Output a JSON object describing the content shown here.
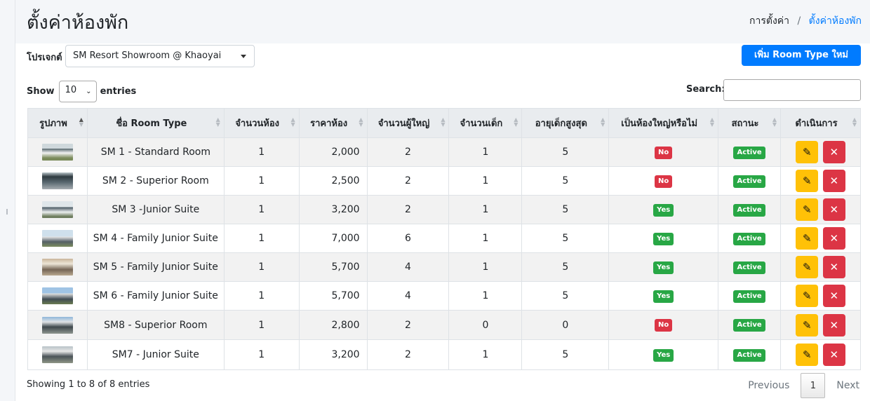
{
  "header": {
    "title": "ตั้งค่าห้องพัก",
    "breadcrumb": [
      "การตั้งค่า",
      "ตั้งค่าห้องพัก"
    ]
  },
  "filters": {
    "project_label": "โปรเจกต์",
    "project_value": "SM Resort Showroom @ Khaoyai",
    "add_button": "เพิ่ม Room Type ใหม่",
    "show_label": "Show",
    "entries_value": "10",
    "entries_label": "entries",
    "search_label": "Search:",
    "search_value": ""
  },
  "table": {
    "columns": [
      "รูปภาพ",
      "ชื่อ Room Type",
      "จำนวนห้อง",
      "ราคาห้อง",
      "จำนวนผู้ใหญ่",
      "จำนวนเด็ก",
      "อายุเด็กสูงสุด",
      "เป็นห้องใหญ่หรือไม่",
      "สถานะ",
      "ดำเนินการ"
    ],
    "rows": [
      {
        "name": "SM 1 - Standard Room",
        "rooms": "1",
        "price": "2,000",
        "adults": "2",
        "children": "1",
        "max_child_age": "5",
        "large": "No",
        "status": "Active"
      },
      {
        "name": "SM 2 - Superior Room",
        "rooms": "1",
        "price": "2,500",
        "adults": "2",
        "children": "1",
        "max_child_age": "5",
        "large": "No",
        "status": "Active"
      },
      {
        "name": "SM 3 -Junior Suite",
        "rooms": "1",
        "price": "3,200",
        "adults": "2",
        "children": "1",
        "max_child_age": "5",
        "large": "Yes",
        "status": "Active"
      },
      {
        "name": "SM 4 - Family Junior Suite",
        "rooms": "1",
        "price": "7,000",
        "adults": "6",
        "children": "1",
        "max_child_age": "5",
        "large": "Yes",
        "status": "Active"
      },
      {
        "name": "SM 5 - Family Junior Suite",
        "rooms": "1",
        "price": "5,700",
        "adults": "4",
        "children": "1",
        "max_child_age": "5",
        "large": "Yes",
        "status": "Active"
      },
      {
        "name": "SM 6 - Family Junior Suite",
        "rooms": "1",
        "price": "5,700",
        "adults": "4",
        "children": "1",
        "max_child_age": "5",
        "large": "Yes",
        "status": "Active"
      },
      {
        "name": "SM8 - Superior Room",
        "rooms": "1",
        "price": "2,800",
        "adults": "2",
        "children": "0",
        "max_child_age": "0",
        "large": "No",
        "status": "Active"
      },
      {
        "name": "SM7 - Junior Suite",
        "rooms": "1",
        "price": "3,200",
        "adults": "2",
        "children": "1",
        "max_child_age": "5",
        "large": "Yes",
        "status": "Active"
      }
    ]
  },
  "footer": {
    "info": "Showing 1 to 8 of 8 entries",
    "previous": "Previous",
    "current_page": "1",
    "next": "Next"
  },
  "icons": {
    "edit": "pencil-icon",
    "delete": "x-icon",
    "sort": "sort-arrows-icon",
    "dropdown": "caret-down-icon"
  },
  "colors": {
    "primary": "#007bff",
    "success": "#28a745",
    "danger": "#dc3545",
    "warning": "#ffc107"
  }
}
